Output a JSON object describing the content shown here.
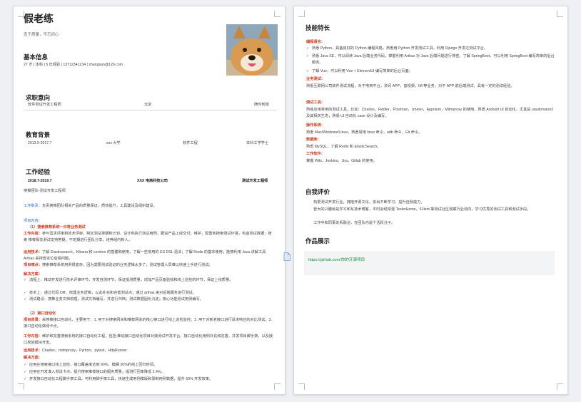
{
  "page1": {
    "name": "假老练",
    "slogan": "忠于质量，不忘初心",
    "basic": {
      "heading": "基本信息",
      "details": "27 岁 | 本科 | 5 年经验 | 13712341234 | zhangsan@126.com"
    },
    "intent": {
      "heading": "求职意向",
      "position": "软件测试开发工程师",
      "city": "北京",
      "availability": "随时到岗"
    },
    "education": {
      "heading": "教育背景",
      "period": "2013.9-2017.7",
      "school": "xxx 大学",
      "major": "软件工程",
      "degree": "本科工学学士"
    },
    "work": {
      "heading": "工作经验",
      "period": "2018.7-2019.7",
      "company": "XXX 电商科技公司",
      "title": "测试开发工程师",
      "team": "搜推团队-测试开发工程师",
      "duty_label": "工作职责：",
      "duty": "负责搜推团队相关产品的质量保证，质效提升，工具建设及组织建设。"
    },
    "projects": {
      "heading": "项目内容：",
      "p1_title": "（1）搜索推荐系统一日常业务测试",
      "p1_content_label": "工作内容：",
      "p1_content": "参与需求评审和技术评审，制定测试排期和计划，设计和执行测试用例，跟进产品上线交付；维护，配置和搜索测试环境，构造测试数据；搜索 推荐相关测试支持答疑，不定期进行团队分享，培养组内新人。",
      "p1_tech_label": "运用技术：",
      "p1_tech": "了解 Elasticsearch，Kibana 和 cerebro 的搭建和使用，了解一些常用的 ES DSL 语法；了解 Redis 的基本使用；能够利用 Java 讲解工具 Arthas 来排查定位后端问题。",
      "p1_difficulty_label": "项目难点：",
      "p1_difficulty": "搜索推荐系统用例很庞杂，因为需要测试验证的业务逻辑太多了，测试管理人员难以快速上手进行测试。",
      "p1_solution_label": "解决方案：",
      "p1_s1": "流程上：推动开发进行技术评审环节，开发自测环节，保证提测质量；增加产品页面验收和线上巡检的环节，保证上线质量。",
      "p1_s2": "技术上：通过代码 Diff，梳理业务逻辑，以此补充和完善测试点；通过 arthas 来对后端服务进行测试。",
      "p1_s3": "测试建设：搜推业务文档梳理；测试文档编写，并进行归档；测试数据固化沉淀；核心功能测试用例编写。",
      "p2_title": "（2）接口自动化",
      "p2_background_label": "项目背景：",
      "p2_background": "采搜推接口自动化，主要用于：1. 用于对搜索网关和推荐网关的核心接口进行线上巡检监控。2. 用于对新老接口进行请求响应的对比测试。3. 接口自动化做测卡点。",
      "p2_content_label": "工作内容：",
      "p2_content": "维护和完善搜索系统的接口自动化工程，包括:推动接口自动化项目对接测试开发平台，接口自动化用例补充和完善，并发项目脚手架，以及接口校验模块开发。",
      "p2_tech_label": "运用技术：",
      "p2_tech": "Charles，mitmproxy，Python，pytest，HttpRunner",
      "p2_solution_label": "解决方案：",
      "p2_s1": "应用在搜索接口线上巡检，接口覆盖率达到 90%，模糊 30%的线上回归时间。",
      "p2_s2": "应用在开发准入测试卡点，提升搜索推荐接口的服务质量，提测打回率降低 2.4%。",
      "p2_s3": "开发接口自动化工程脚手架工具，可利用脚手架工具，快速生成用例模版和录制用例数据，提升 50% 开发效率。"
    }
  },
  "page2": {
    "skills": {
      "heading": "技能特长",
      "programming_label": "编程语言：",
      "prog1": "熟悉 Python，具备良好的 Python 编程风格，熟悉用 Python 开发测试工具，利用 Django 开发过测试平台。",
      "prog2": "熟悉 Java SE，可以阅读 Java 后端业务代码，掌握利用 Arthas 对 Java 后端问题进行排查。了解 SpringBoot，可以利用 SpringBoot 编写简单的后台服务。",
      "prog3": "了解 Vue，可以利用 Vue + ElementUI 编写简单的后台页面。",
      "business_label": "业务测试：",
      "business": "熟悉互联网公司软件测试流程，对于电商平台，资讯 APP，音视频，IM 等业务，对于 APP 前后端测试，具有一定的测试经验。",
      "tools_label": "测试工具：",
      "tools": "熟练应用常用的测试工具，比如：Charles，Fiddler，Postman，Jmeter，Appnium，Mitmproxy 的使用。熟悉 Android UI 自动化，尤其是 uiautomator2 及其相关生态，熟悉 UI 自动化 case 设计及编写。",
      "os_label": "操作系统：",
      "os": "熟悉 Mac/Windows/Linux，熟悉常用 linux 命令，adb 命令，Git 命令。",
      "db_label": "数据库：",
      "db": "熟悉 MySQL，了解 Redis 和 ElasticSearch。",
      "software_label": "工作软件：",
      "software": "掌握 Wiki，Jenkins，Jira，Gitlab 的使用。"
    },
    "self_eval": {
      "heading": "自我评价",
      "line1": "热爱测试开发行业，拥抱开源文化，崇尚不断学习，提升自我能力。",
      "line2": "曾大的兴趣就是学习和写技术博客，平时会经常逛 TesterHome，51test 等测试社区观察行业动向，学习优秀的测试工具和测试手段。",
      "line3": "工作中和同事关系融洽，在团队内是个活跃分子。"
    },
    "portfolio": {
      "heading": "作品展示",
      "link": "https://github.com/你的开源项目"
    }
  },
  "colors": {
    "accent_red": "#d23a1e",
    "accent_blue": "#2a6ed8",
    "link_green": "#1f8f3a"
  }
}
